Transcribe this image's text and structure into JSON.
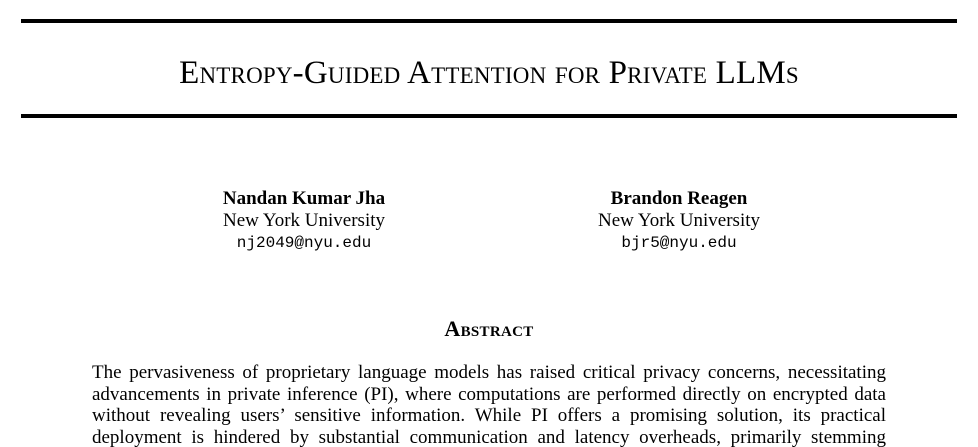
{
  "paper": {
    "title": "Entropy-Guided Attention for Private LLMs",
    "authors": [
      {
        "name": "Nandan Kumar Jha",
        "affiliation": "New York University",
        "email": "nj2049@nyu.edu"
      },
      {
        "name": "Brandon Reagen",
        "affiliation": "New York University",
        "email": "bjr5@nyu.edu"
      }
    ],
    "abstract_heading": "Abstract",
    "abstract_lines": [
      "The pervasiveness of proprietary language models has raised critical privacy concerns, necessitating",
      "advancements in private inference (PI), where computations are performed directly on encrypted data",
      "without revealing users’ sensitive information. While PI offers a promising solution, its practical",
      "deployment is hindered by substantial communication and latency overheads, primarily stemming"
    ]
  }
}
